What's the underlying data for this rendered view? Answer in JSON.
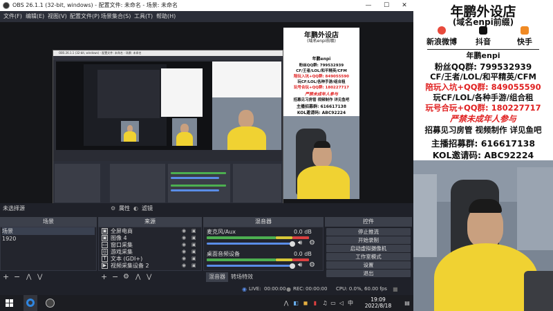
{
  "window": {
    "title": "OBS 26.1.1 (32-bit, windows) - 配置文件: 未命名 - 场景: 未命名",
    "minimize": "—",
    "maximize": "☐",
    "close": "✕"
  },
  "menu": {
    "items": [
      "文件(F)",
      "编辑(E)",
      "视图(V)",
      "配置文件(P)",
      "场景集合(S)",
      "工具(T)",
      "帮助(H)"
    ]
  },
  "dock_labels": {
    "no_source": "未选择源",
    "properties": "属性",
    "filters": "滤镜"
  },
  "scenes": {
    "header": "场景",
    "items": [
      "场景",
      "1920"
    ]
  },
  "sources": {
    "header": "来源",
    "items": [
      {
        "icon": "image-icon",
        "glyph": "▣",
        "label": "全屏电商"
      },
      {
        "icon": "image-icon",
        "glyph": "▣",
        "label": "图像 4"
      },
      {
        "icon": "window-capture-icon",
        "glyph": "▭",
        "label": "窗口采集"
      },
      {
        "icon": "game-capture-icon",
        "glyph": "◎",
        "label": "游戏采集"
      },
      {
        "icon": "text-icon",
        "glyph": "T",
        "label": "文本 (GDI+)"
      },
      {
        "icon": "video-device-icon",
        "glyph": "▶",
        "label": "视频采集设备 2"
      }
    ]
  },
  "mixer": {
    "header": "混音器",
    "channels": [
      {
        "name": "麦克风/Aux",
        "db": "0.0 dB"
      },
      {
        "name": "桌面音频设备",
        "db": "0.0 dB"
      }
    ],
    "tabs": [
      "混音器",
      "转场特效"
    ]
  },
  "controls": {
    "header": "控件",
    "buttons": [
      "停止推流",
      "开始录制",
      "启动虚拟摄像机",
      "工作室模式",
      "设置",
      "退出"
    ]
  },
  "status": {
    "live_label": "LIVE:",
    "live_time": "00:00:00",
    "rec_label": "REC:",
    "rec_time": "00:00:00",
    "cpu": "CPU: 0.0%, 60.00 fps"
  },
  "taskbar": {
    "time": "19:09",
    "date": "2022/8/18",
    "lang": "中"
  },
  "promo": {
    "shop_name": "年鹏外设店",
    "shop_sub": "(域名enpi前缀)",
    "weibo": "新浪微博",
    "douyin": "抖音",
    "kuaishou": "快手",
    "account": "年鹏enpi",
    "qq_group": "粉丝QQ群: 799532939",
    "games": "CF/王者/LOL/和平精英/CFM",
    "join_group": "陪玩入坑+QQ群: 849055590",
    "play_cf": "玩CF/LOL/各种手游/组合租",
    "rent_group": "玩号合玩+QQ群: 180227717",
    "minor_warning": "严禁未成年人参与",
    "recruit": "招募见习房管 视频制作 详见鱼吧",
    "anchor_group": "主播招募群: 616617138",
    "kol_code": "KOL邀请码: ABC92224"
  },
  "colors": {
    "accent_blue": "#5a8de8",
    "meter_green": "#4caf50",
    "meter_yellow": "#d8c838",
    "meter_red": "#d94040",
    "promo_red": "#e02020",
    "shirt_yellow": "#f0d232"
  }
}
